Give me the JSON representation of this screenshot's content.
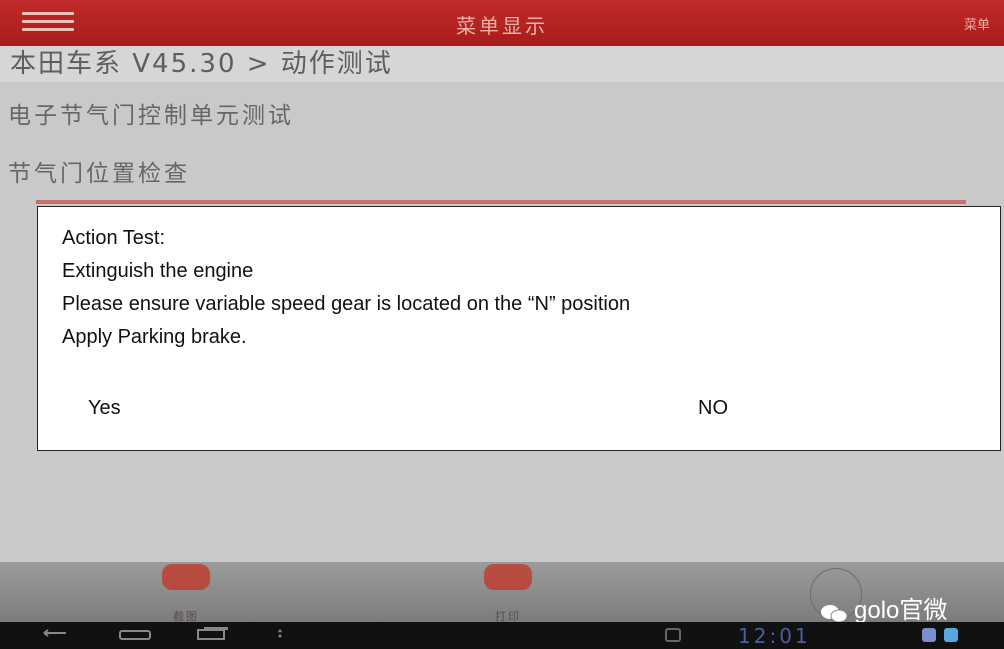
{
  "topbar": {
    "title": "菜单显示",
    "right_label": "菜单"
  },
  "breadcrumb": "本田车系 V45.30 > 动作测试",
  "list": {
    "item1": "电子节气门控制单元测试",
    "item2": "节气门位置检查"
  },
  "dialog": {
    "line1": "Action Test:",
    "line2": "Extinguish the engine",
    "line3": "Please ensure variable speed gear is located on the “N” position",
    "line4": "Apply Parking brake.",
    "yes_label": "Yes",
    "no_label": "NO"
  },
  "toolbar": {
    "tool1_label": "截图",
    "tool2_label": "打印"
  },
  "watermark": "golo官微",
  "statusbar": {
    "clock": "12:01"
  },
  "colors": {
    "accent": "#b82222",
    "nav_bg": "#111111"
  }
}
